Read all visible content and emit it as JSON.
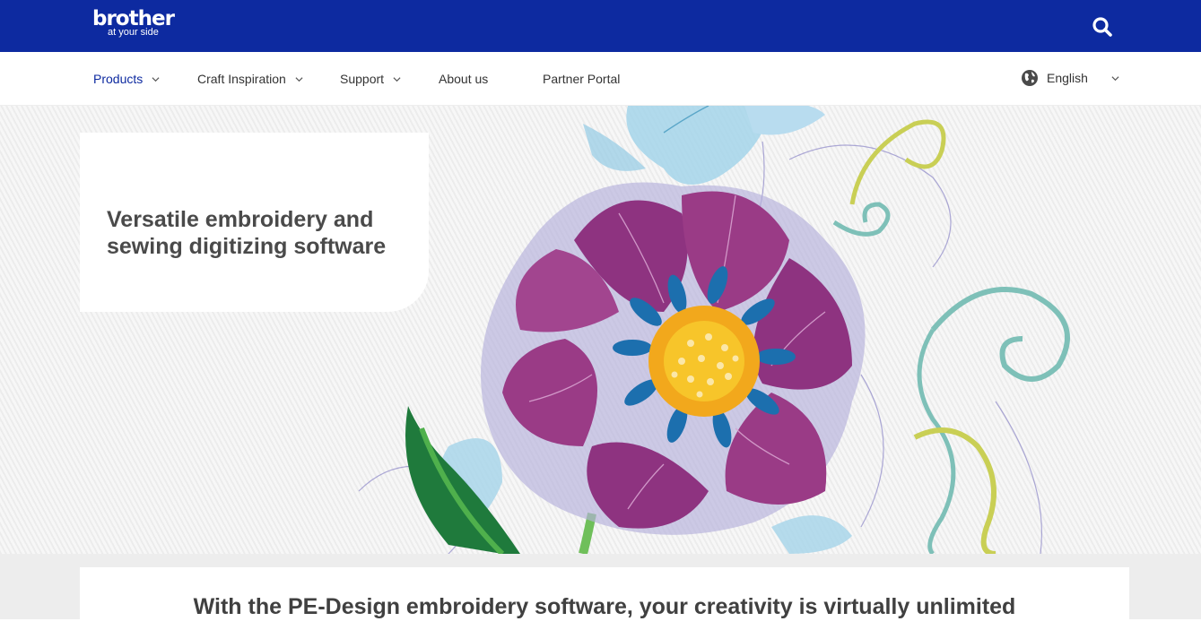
{
  "header": {
    "brand": "brother",
    "tagline": "at your side",
    "search_icon": "search-icon",
    "bg_color": "#0d2aa0"
  },
  "nav": {
    "items": [
      {
        "label": "Products",
        "has_dropdown": true
      },
      {
        "label": "Craft Inspiration",
        "has_dropdown": true
      },
      {
        "label": "Support",
        "has_dropdown": true
      },
      {
        "label": "About us",
        "has_dropdown": false
      },
      {
        "label": "Partner Portal",
        "has_dropdown": false
      }
    ],
    "language": {
      "label": "English",
      "icon": "globe-icon"
    }
  },
  "hero": {
    "title": "Versatile embroidery and sewing digitizing software",
    "image": "embroidered-flower-image"
  },
  "intro": {
    "headline": "With the PE-Design embroidery software, your creativity is virtually unlimited"
  },
  "colors": {
    "brand_blue": "#0d2aa0",
    "flower_magenta": "#9a3b86",
    "flower_center": "#f2a81c",
    "stamen_blue": "#1c6fae",
    "leaf_green": "#1f7a3c"
  }
}
